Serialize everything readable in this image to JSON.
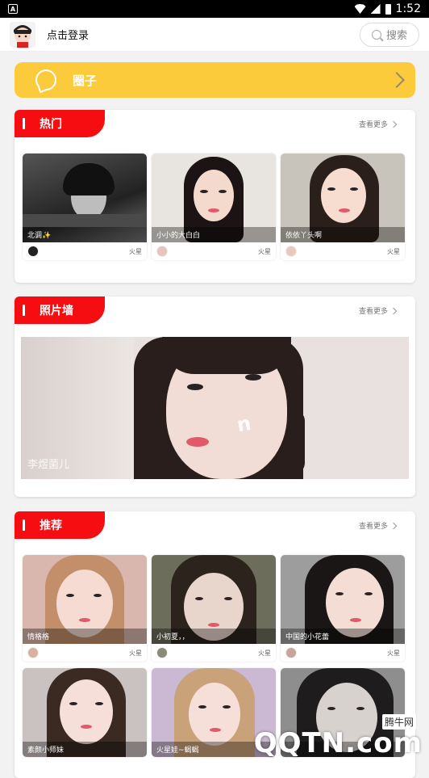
{
  "status_bar": {
    "app_badge": "A",
    "time": "1:52"
  },
  "header": {
    "login_text": "点击登录",
    "search_label": "搜索"
  },
  "circle_banner": {
    "title": "圈子",
    "color": "#fccb3c"
  },
  "hot": {
    "title": "热门",
    "more_label": "查看更多",
    "items": [
      {
        "name": "北调✨",
        "source": "火星"
      },
      {
        "name": "小小的大白白",
        "source": "火星"
      },
      {
        "name": "依依丫头啊",
        "source": "火星"
      }
    ]
  },
  "photo_wall": {
    "title": "照片墙",
    "more_label": "查看更多",
    "caption": "李煜菌儿"
  },
  "recommend": {
    "title": "推荐",
    "more_label": "查看更多",
    "items": [
      {
        "name": "情格格",
        "source": "火星"
      },
      {
        "name": "小初夏，，",
        "source": "火星"
      },
      {
        "name": "中国的小花蕾",
        "source": "火星"
      },
      {
        "name": "素颜小师妹",
        "source": ""
      },
      {
        "name": "火星娃~蝎蝎",
        "source": ""
      },
      {
        "name": "",
        "source": ""
      }
    ]
  },
  "watermark": {
    "logo": "QQTN.com",
    "cn": "腾牛网"
  },
  "colors": {
    "accent_red": "#f50d12",
    "banner_yellow": "#fccb3c"
  }
}
